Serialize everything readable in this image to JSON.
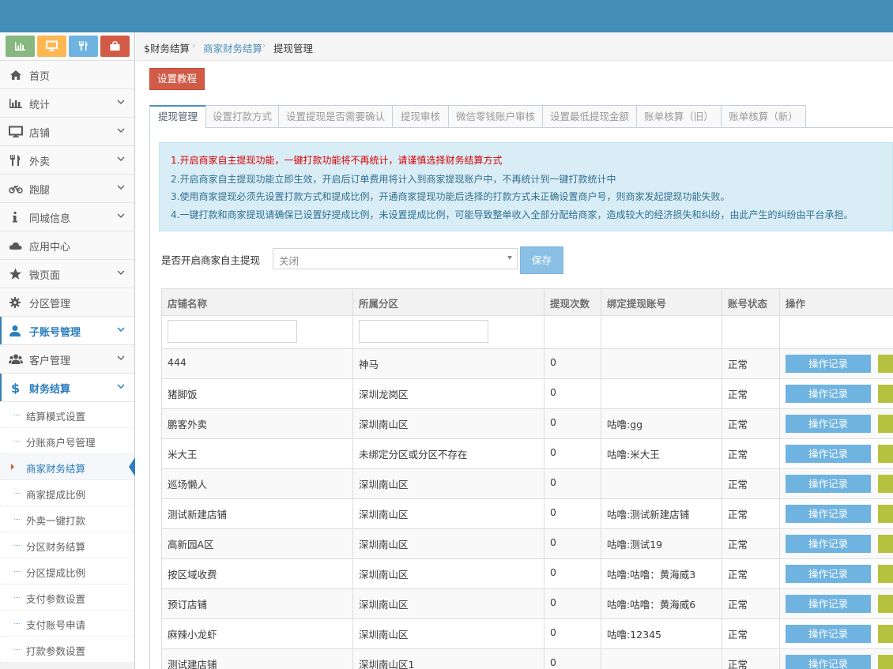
{
  "colors": {
    "topbar": "#438eb9",
    "accent": "#2b7dbc",
    "danger": "#d15b47",
    "alert_bg": "#d9edf7"
  },
  "shortcuts": [
    {
      "name": "chart-icon",
      "color": "#87b87f"
    },
    {
      "name": "monitor-icon",
      "color": "#ffb752"
    },
    {
      "name": "cutlery-icon",
      "color": "#6fb3e0"
    },
    {
      "name": "bag-icon",
      "color": "#d15b47"
    }
  ],
  "sidebar": {
    "items": [
      {
        "label": "首页",
        "icon": "home-icon",
        "chevron": false
      },
      {
        "label": "统计",
        "icon": "bar-chart-icon",
        "chevron": true
      },
      {
        "label": "店铺",
        "icon": "monitor-icon",
        "chevron": true
      },
      {
        "label": "外卖",
        "icon": "cutlery-icon",
        "chevron": true
      },
      {
        "label": "跑腿",
        "icon": "bicycle-icon",
        "chevron": true
      },
      {
        "label": "同城信息",
        "icon": "info-icon",
        "chevron": true
      },
      {
        "label": "应用中心",
        "icon": "cloud-icon",
        "chevron": false
      },
      {
        "label": "微页面",
        "icon": "star-icon",
        "chevron": true
      },
      {
        "label": "分区管理",
        "icon": "gear-icon",
        "chevron": false
      },
      {
        "label": "子账号管理",
        "icon": "user-icon",
        "chevron": true
      },
      {
        "label": "客户管理",
        "icon": "users-icon",
        "chevron": true
      },
      {
        "label": "财务结算",
        "icon": "dollar-icon",
        "chevron": true
      }
    ],
    "submenu": [
      "结算模式设置",
      "分账商户号管理",
      "商家财务结算",
      "商家提成比例",
      "外卖一键打款",
      "分区财务结算",
      "分区提成比例",
      "支付参数设置",
      "支付账号申请",
      "打款参数设置"
    ]
  },
  "breadcrumb": {
    "root": "财务结算",
    "middle": "商家财务结算",
    "current": "提现管理",
    "root_icon": "$"
  },
  "tutorial_button": "设置教程",
  "tabs": [
    "提现管理",
    "设置打款方式",
    "设置提现是否需要确认",
    "提现审核",
    "微信零钱账户审核",
    "设置最低提现金额",
    "账单核算（旧）",
    "账单核算（新）"
  ],
  "alert": {
    "lines": [
      "1.开启商家自主提现功能，一键打款功能将不再统计，请谨慎选择财务结算方式",
      "2.开启商家自主提现功能立即生效，开启后订单费用将计入到商家提现账户中，不再统计到一键打款统计中",
      "3.使用商家提现必须先设置打款方式和提成比例，开通商家提现功能后选择的打款方式未正确设置商户号，则商家发起提现功能失败。",
      "4.一键打款和商家提现请确保已设置好提成比例，未设置提成比例，可能导致整单收入全部分配给商家，造成较大的经济损失和纠纷，由此产生的纠纷由平台承担。"
    ]
  },
  "form": {
    "label": "是否开启商家自主提现",
    "select_value": "关闭",
    "save_label": "保存"
  },
  "table": {
    "headers": [
      "店铺名称",
      "所属分区",
      "提现次数",
      "绑定提现账号",
      "账号状态",
      "操作"
    ],
    "log_label": "操作记录",
    "rows": [
      [
        "444",
        "神马",
        "0",
        "",
        "正常"
      ],
      [
        "猪脚饭",
        "深圳龙岗区",
        "0",
        "",
        "正常"
      ],
      [
        "鹏客外卖",
        "深圳南山区",
        "0",
        "咕噜:gg",
        "正常"
      ],
      [
        "米大王",
        "未绑定分区或分区不存在",
        "0",
        "咕噜:米大王",
        "正常"
      ],
      [
        "巡场懒人",
        "深圳南山区",
        "0",
        "",
        "正常"
      ],
      [
        "测试新建店铺",
        "深圳南山区",
        "0",
        "咕噜:测试新建店铺",
        "正常"
      ],
      [
        "高新园A区",
        "深圳南山区",
        "0",
        "咕噜:测试19",
        "正常"
      ],
      [
        "按区域收费",
        "深圳南山区",
        "0",
        "咕噜:咕噜：黄海威3",
        "正常"
      ],
      [
        "预订店铺",
        "深圳南山区",
        "0",
        "咕噜:咕噜：黄海威6",
        "正常"
      ],
      [
        "麻辣小龙虾",
        "深圳南山区",
        "0",
        "咕噜:12345",
        "正常"
      ],
      [
        "测试建店铺",
        "深圳南山区1",
        "0",
        "",
        "正常"
      ]
    ]
  }
}
